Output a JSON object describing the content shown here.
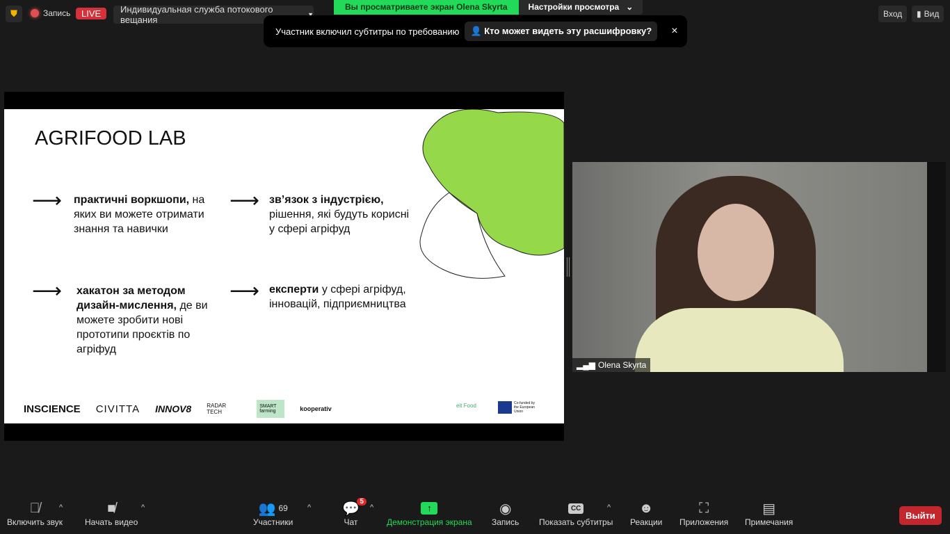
{
  "topbar": {
    "record_label": "Запись",
    "live_badge": "LIVE",
    "stream_service": "Индивидуальная служба потокового вещания",
    "viewing_banner": "Вы просматриваете экран Olena Skyrta",
    "view_settings": "Настройки просмотра",
    "login": "Вход",
    "view": "Вид"
  },
  "toast": {
    "message": "Участник включил субтитры по требованию",
    "who_can_see": "Кто может видеть эту расшифровку?",
    "close": "×"
  },
  "slide": {
    "title": "AGRIFOOD LAB",
    "items": [
      {
        "bold": "практичні воркшопи,",
        "rest": "на яких ви можете отримати знання та навички"
      },
      {
        "bold": "зв’язок з індустрією,",
        "rest": "рішення, які будуть корисні у сфері агріфуд"
      },
      {
        "bold": "хакатон за методом дизайн-мислення,",
        "rest": "де ви можете зробити нові прототипи проєктів по агріфуд"
      },
      {
        "bold": "експерти",
        "rest": "у сфері агріфуд, інновацій, підприємництва"
      }
    ],
    "logos": [
      "INSCIENCE",
      "CIVITTA",
      "INNOV8",
      "RADAR TECH",
      "SMART farming",
      "kooperativ",
      "eit Food",
      "Co-funded by the European Union"
    ]
  },
  "video": {
    "name": "Olena Skyrta"
  },
  "toolbar": {
    "unmute": "Включить звук",
    "start_video": "Начать видео",
    "participants": "Участники",
    "participants_count": "69",
    "chat": "Чат",
    "chat_badge": "5",
    "share": "Демонстрация экрана",
    "record": "Запись",
    "captions": "Показать субтитры",
    "reactions": "Реакции",
    "apps": "Приложения",
    "notes": "Примечания",
    "leave": "Выйти"
  },
  "colors": {
    "accent": "#23d959",
    "live": "#e02828",
    "leave": "#c4262e"
  }
}
